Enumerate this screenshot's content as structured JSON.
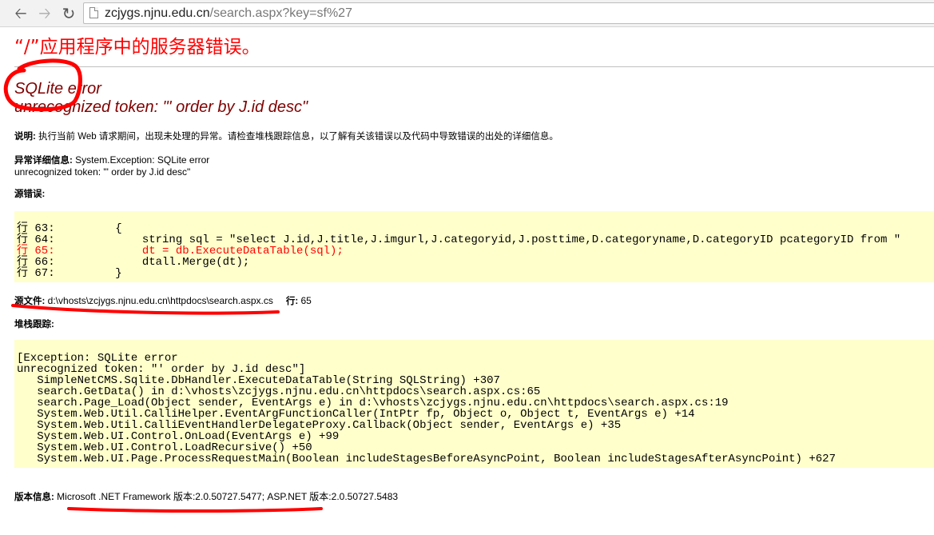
{
  "browser": {
    "url_host": "zcjygs.njnu.edu.cn",
    "url_path": "/search.aspx?key=sf%27",
    "back_icon": "arrow-left-icon",
    "forward_icon": "arrow-right-icon",
    "reload_icon": "reload-icon"
  },
  "error": {
    "title": "“/”应用程序中的服务器错误。",
    "heading_line1": "SQLite error",
    "heading_line2": "unrecognized token: \"' order by J.id desc\"",
    "description_label": "说明:",
    "description_text": " 执行当前 Web 请求期间，出现未处理的异常。请检查堆栈跟踪信息，以了解有关该错误以及代码中导致错误的出处的详细信息。",
    "exception_label": "异常详细信息:",
    "exception_line1": " System.Exception: SQLite error",
    "exception_line2": "unrecognized token: \"' order by J.id desc\"",
    "source_error_label": "源错误:",
    "source_lines": [
      {
        "text": "行 63:         {",
        "highlight": false
      },
      {
        "text": "行 64:             string sql = \"select J.id,J.title,J.imgurl,J.categoryid,J.posttime,D.categoryname,D.categoryID pcategoryID from \"",
        "highlight": false
      },
      {
        "text": "行 65:             dt = db.ExecuteDataTable(sql);",
        "highlight": true
      },
      {
        "text": "行 66:             dtall.Merge(dt);",
        "highlight": false
      },
      {
        "text": "行 67:         }",
        "highlight": false
      }
    ],
    "source_file_label": "源文件:",
    "source_file_path": " d:\\vhosts\\zcjygs.njnu.edu.cn\\httpdocs\\search.aspx.cs",
    "line_label": "行:",
    "line_number": " 65",
    "stack_trace_label": "堆栈跟踪:",
    "stack_lines": [
      "[Exception: SQLite error",
      "unrecognized token: \"' order by J.id desc\"]",
      "   SimpleNetCMS.Sqlite.DbHandler.ExecuteDataTable(String SQLString) +307",
      "   search.GetData() in d:\\vhosts\\zcjygs.njnu.edu.cn\\httpdocs\\search.aspx.cs:65",
      "   search.Page_Load(Object sender, EventArgs e) in d:\\vhosts\\zcjygs.njnu.edu.cn\\httpdocs\\search.aspx.cs:19",
      "   System.Web.Util.CalliHelper.EventArgFunctionCaller(IntPtr fp, Object o, Object t, EventArgs e) +14",
      "   System.Web.Util.CalliEventHandlerDelegateProxy.Callback(Object sender, EventArgs e) +35",
      "   System.Web.UI.Control.OnLoad(EventArgs e) +99",
      "   System.Web.UI.Control.LoadRecursive() +50",
      "   System.Web.UI.Page.ProcessRequestMain(Boolean includeStagesBeforeAsyncPoint, Boolean includeStagesAfterAsyncPoint) +627"
    ],
    "version_label": "版本信息:",
    "version_text": " Microsoft .NET Framework 版本:2.0.50727.5477; ASP.NET 版本:2.0.50727.5483"
  },
  "colors": {
    "title_red": "#ff0000",
    "heading_maroon": "#800000",
    "code_background": "#ffffcc",
    "annotation_red": "#ff0000"
  }
}
